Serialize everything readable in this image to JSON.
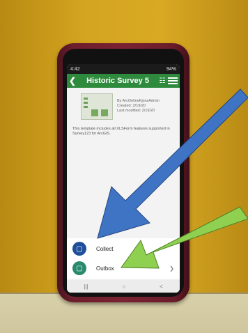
{
  "status_bar": {
    "time": "4:42",
    "battery": "94%"
  },
  "header": {
    "title": "Historic Survey 5"
  },
  "survey": {
    "author": "By ArcOnlineKjossAdmin",
    "created": "Created: 2/19/20",
    "modified": "Last modified: 2/19/20",
    "description": "This template includes all XLSForm features supported in Survey123 for ArcGIS."
  },
  "actions": {
    "collect_label": "Collect",
    "outbox_label": "Outbox"
  },
  "colors": {
    "header_green": "#2e8a3c",
    "collect_blue": "#1f4f9a",
    "outbox_teal": "#2a8a6e",
    "arrow_blue": "#3f74c4",
    "arrow_green": "#8fd050"
  },
  "icons": {
    "back": "back-arrow-icon",
    "map": "map-icon",
    "menu": "hamburger-menu-icon",
    "collect": "new-form-icon",
    "outbox": "outbox-icon"
  }
}
